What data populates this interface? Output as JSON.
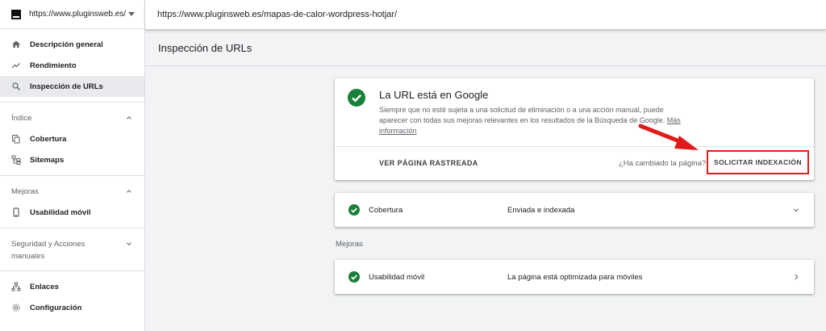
{
  "property": {
    "url": "https://www.pluginsweb.es/"
  },
  "sidebar": {
    "top_items": [
      {
        "label": "Descripción general",
        "icon": "home-icon"
      },
      {
        "label": "Rendimiento",
        "icon": "trending-up-icon"
      },
      {
        "label": "Inspección de URLs",
        "icon": "search-icon",
        "active": true
      }
    ],
    "sections": [
      {
        "title": "Índice",
        "items": [
          {
            "label": "Cobertura",
            "icon": "copy-icon"
          },
          {
            "label": "Sitemaps",
            "icon": "sitemap-icon"
          }
        ]
      },
      {
        "title": "Mejoras",
        "items": [
          {
            "label": "Usabilidad móvil",
            "icon": "phone-icon"
          }
        ]
      },
      {
        "title": "Seguridad y Acciones manuales",
        "items": []
      }
    ],
    "bottom_items": [
      {
        "label": "Enlaces",
        "icon": "links-icon"
      },
      {
        "label": "Configuración",
        "icon": "gear-icon"
      }
    ]
  },
  "topbar": {
    "inspected_url": "https://www.pluginsweb.es/mapas-de-calor-wordpress-hotjar/"
  },
  "page": {
    "title": "Inspección de URLs"
  },
  "status_card": {
    "title": "La URL está en Google",
    "description": "Siempre que no esté sujeta a una solicitud de eliminación o a una acción manual, puede aparecer con todas sus mejoras relevantes en los resultados de la Búsqueda de Google.",
    "more_link": "Más información",
    "view_crawled": "VER PÁGINA RASTREADA",
    "changed_question": "¿Ha cambiado la página?",
    "request_indexing": "SOLICITAR INDEXACIÓN"
  },
  "coverage": {
    "label": "Cobertura",
    "value": "Enviada e indexada"
  },
  "improvements": {
    "heading": "Mejoras",
    "mobile": {
      "label": "Usabilidad móvil",
      "value": "La página está optimizada para móviles"
    }
  },
  "colors": {
    "success": "#188038",
    "highlight": "#e01b1b"
  }
}
